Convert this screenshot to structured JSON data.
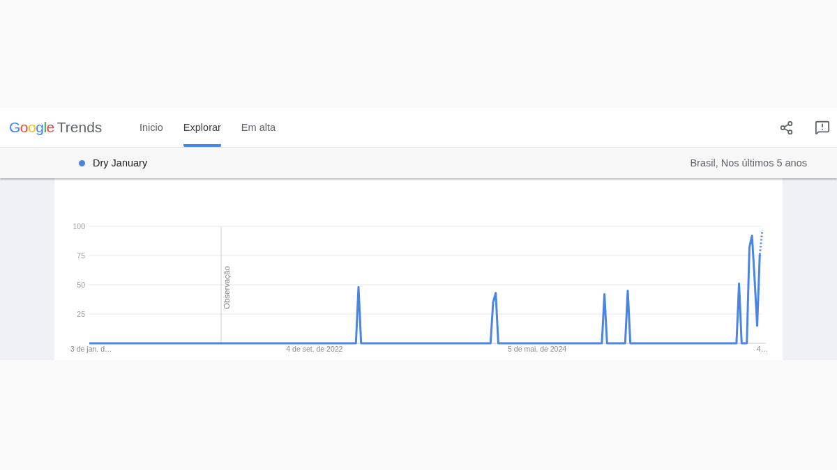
{
  "header": {
    "logo": {
      "brand": "Google",
      "product": "Trends"
    },
    "tabs": [
      {
        "label": "Inicio",
        "selected": false
      },
      {
        "label": "Explorar",
        "selected": true
      },
      {
        "label": "Em alta",
        "selected": false
      }
    ]
  },
  "comparison": {
    "scope": "Brasil, Nos últimos 5 anos"
  },
  "observation_note": "Observação",
  "chart_data": {
    "type": "line",
    "grid": true,
    "ylim": [
      0,
      100
    ],
    "yticks": [
      25,
      50,
      75,
      100
    ],
    "categories": [
      "3 de jan. d…",
      null,
      null,
      null,
      null,
      null,
      null,
      null,
      null,
      null,
      null,
      null,
      null,
      null,
      null,
      null,
      null,
      null,
      null,
      null,
      null,
      null,
      null,
      null,
      null,
      null,
      null,
      null,
      null,
      null,
      null,
      null,
      null,
      null,
      null,
      null,
      null,
      null,
      null,
      null,
      null,
      null,
      null,
      null,
      null,
      null,
      null,
      null,
      null,
      null,
      null,
      null,
      null,
      null,
      null,
      null,
      null,
      null,
      null,
      null,
      null,
      null,
      null,
      null,
      null,
      null,
      null,
      null,
      null,
      null,
      null,
      null,
      null,
      null,
      null,
      null,
      null,
      null,
      null,
      null,
      null,
      null,
      null,
      null,
      null,
      null,
      null,
      "4 de set. de 2022",
      null,
      null,
      null,
      null,
      null,
      null,
      null,
      null,
      null,
      null,
      null,
      null,
      null,
      null,
      null,
      null,
      null,
      null,
      null,
      null,
      null,
      null,
      null,
      null,
      null,
      null,
      null,
      null,
      null,
      null,
      null,
      null,
      null,
      null,
      null,
      null,
      null,
      null,
      null,
      null,
      null,
      null,
      null,
      null,
      null,
      null,
      null,
      null,
      null,
      null,
      null,
      null,
      null,
      null,
      null,
      null,
      null,
      null,
      null,
      null,
      null,
      null,
      null,
      null,
      null,
      null,
      null,
      null,
      null,
      null,
      null,
      null,
      null,
      null,
      null,
      null,
      null,
      null,
      null,
      null,
      null,
      null,
      null,
      null,
      null,
      "5 de mai. de 2024",
      null,
      null,
      null,
      null,
      null,
      null,
      null,
      null,
      null,
      null,
      null,
      null,
      null,
      null,
      null,
      null,
      null,
      null,
      null,
      null,
      null,
      null,
      null,
      null,
      null,
      null,
      null,
      null,
      null,
      null,
      null,
      null,
      null,
      null,
      null,
      null,
      null,
      null,
      null,
      null,
      null,
      null,
      null,
      null,
      null,
      null,
      null,
      null,
      null,
      null,
      null,
      null,
      null,
      null,
      null,
      null,
      null,
      null,
      null,
      null,
      null,
      null,
      null,
      null,
      null,
      null,
      null,
      null,
      null,
      null,
      null,
      null,
      null,
      null,
      null,
      null,
      null,
      null,
      null,
      null,
      null,
      null,
      null,
      null,
      null,
      null,
      "4…"
    ],
    "series": [
      {
        "name": "Dry January",
        "color": "#4a86e0",
        "values": [
          0,
          0,
          0,
          0,
          0,
          0,
          0,
          0,
          0,
          0,
          0,
          0,
          0,
          0,
          0,
          0,
          0,
          0,
          0,
          0,
          0,
          0,
          0,
          0,
          0,
          0,
          0,
          0,
          0,
          0,
          0,
          0,
          0,
          0,
          0,
          0,
          0,
          0,
          0,
          0,
          0,
          0,
          0,
          0,
          0,
          0,
          0,
          0,
          0,
          0,
          0,
          0,
          0,
          0,
          0,
          0,
          0,
          0,
          0,
          0,
          0,
          0,
          0,
          0,
          0,
          0,
          0,
          0,
          0,
          0,
          0,
          0,
          0,
          0,
          0,
          0,
          0,
          0,
          0,
          0,
          0,
          0,
          0,
          0,
          0,
          0,
          0,
          0,
          0,
          0,
          0,
          0,
          0,
          0,
          0,
          0,
          0,
          0,
          0,
          0,
          0,
          0,
          0,
          0,
          48,
          0,
          0,
          0,
          0,
          0,
          0,
          0,
          0,
          0,
          0,
          0,
          0,
          0,
          0,
          0,
          0,
          0,
          0,
          0,
          0,
          0,
          0,
          0,
          0,
          0,
          0,
          0,
          0,
          0,
          0,
          0,
          0,
          0,
          0,
          0,
          0,
          0,
          0,
          0,
          0,
          0,
          0,
          0,
          0,
          0,
          0,
          0,
          0,
          0,
          0,
          0,
          35,
          43,
          0,
          0,
          0,
          0,
          0,
          0,
          0,
          0,
          0,
          0,
          0,
          0,
          0,
          0,
          0,
          0,
          0,
          0,
          0,
          0,
          0,
          0,
          0,
          0,
          0,
          0,
          0,
          0,
          0,
          0,
          0,
          0,
          0,
          0,
          0,
          0,
          0,
          0,
          0,
          0,
          0,
          42,
          0,
          0,
          0,
          0,
          0,
          0,
          0,
          0,
          45,
          0,
          0,
          0,
          0,
          0,
          0,
          0,
          0,
          0,
          0,
          0,
          0,
          0,
          0,
          0,
          0,
          0,
          0,
          0,
          0,
          0,
          0,
          0,
          0,
          0,
          0,
          0,
          0,
          0,
          0,
          0,
          0,
          0,
          0,
          0,
          0,
          0,
          0,
          0,
          0,
          0,
          0,
          51,
          0,
          0,
          0,
          82,
          92,
          55,
          15,
          76,
          97
        ]
      }
    ]
  }
}
